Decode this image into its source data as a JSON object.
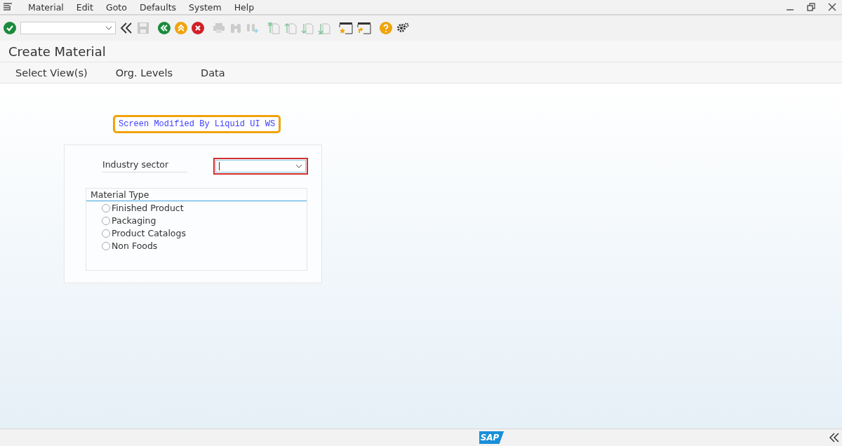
{
  "menu": [
    "Material",
    "Edit",
    "Goto",
    "Defaults",
    "System",
    "Help"
  ],
  "title": "Create Material",
  "app_menu": [
    "Select View(s)",
    "Org. Levels",
    "Data"
  ],
  "banner": "Screen Modified By Liquid UI WS",
  "industry_sector": {
    "label": "Industry sector"
  },
  "material_type": {
    "title": "Material Type",
    "options": [
      {
        "label": "Finished Product",
        "selected": false
      },
      {
        "label": "Packaging",
        "selected": false
      },
      {
        "label": "Product Catalogs",
        "selected": false
      },
      {
        "label": "Non Foods",
        "selected": false
      }
    ]
  },
  "logo": "SAP"
}
